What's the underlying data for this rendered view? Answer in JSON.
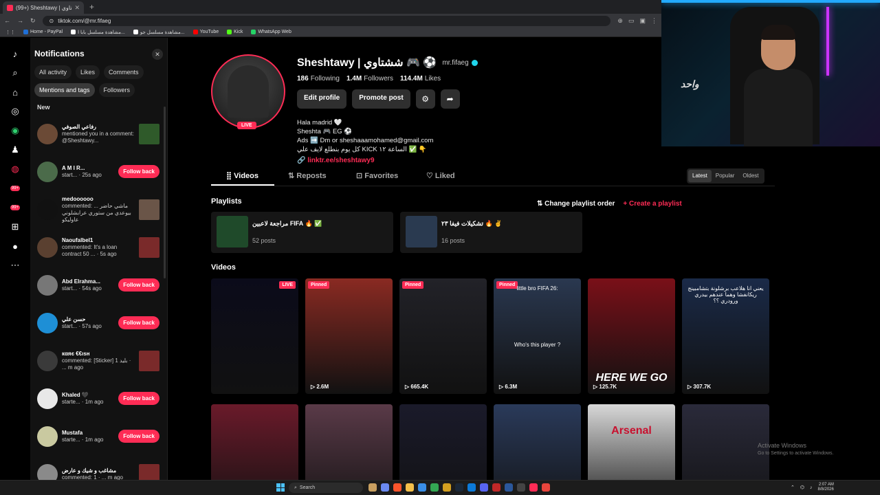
{
  "browser": {
    "tab_title": "(99+) Sheshtawy | شتاوي",
    "url": "tiktok.com/@mr.fifaeg",
    "bookmarks": [
      {
        "label": "Home - PayPal",
        "color": "#1f6fd6"
      },
      {
        "label": "مشاهدة مسلسل بابا ا...",
        "color": "#ffffff"
      },
      {
        "label": "مشاهدة مسلسل جو...",
        "color": "#ffffff"
      },
      {
        "label": "YouTube",
        "color": "#ff0000"
      },
      {
        "label": "Kick",
        "color": "#53fc18"
      },
      {
        "label": "WhatsApp Web",
        "color": "#25d366"
      }
    ]
  },
  "sidebar_badges": [
    "99+",
    "99+"
  ],
  "notifications": {
    "title": "Notifications",
    "filters": [
      "All activity",
      "Likes",
      "Comments",
      "Mentions and tags",
      "Followers"
    ],
    "active_filter": "Mentions and tags",
    "section": "New",
    "items": [
      {
        "name": "رفاعي الصوفي",
        "text": "mentioned you in a comment: @Sheshtawy...",
        "action": "",
        "avatar": "#6b4a36",
        "thumb": "#2f5a2a"
      },
      {
        "name": "A M I R...",
        "text": "start... · 25s ago",
        "action": "Follow back",
        "avatar": "#4b6b4a",
        "thumb": ""
      },
      {
        "name": "medoooooo",
        "text": "commented: ماشي حاضر ... بيوعدي من ستوري عرابشلوني عاوليكو",
        "action": "",
        "avatar": "#111111",
        "thumb": "#6a5548"
      },
      {
        "name": "Naoufalbel1",
        "text": "commented: It's a loan contract 50 ... · 5s ago",
        "action": "",
        "avatar": "#5a4030",
        "thumb": "#7a2a2a"
      },
      {
        "name": "Abd Elrahma...",
        "text": "start... · 54s ago",
        "action": "Follow back",
        "avatar": "#777777",
        "thumb": ""
      },
      {
        "name": "حسن علي",
        "text": "start... · 57s ago",
        "action": "Follow back",
        "avatar": "#1e8fd6",
        "thumb": ""
      },
      {
        "name": "кαяє €€ısн",
        "text": "commented: [Sticker] بليد 1 · ... m ago",
        "action": "",
        "avatar": "#3a3a3a",
        "thumb": "#7a2a2a"
      },
      {
        "name": "Khaled 🖤",
        "text": "starte... · 1m ago",
        "action": "Follow back",
        "avatar": "#e8e8e8",
        "thumb": ""
      },
      {
        "name": "Mustafa",
        "text": "starte... · 1m ago",
        "action": "Follow back",
        "avatar": "#c9c9a0",
        "thumb": ""
      },
      {
        "name": "مشاغب و شيك و عارض",
        "text": "commented: 1 · ... m ago",
        "action": "",
        "avatar": "#8a8a8a",
        "thumb": "#7a2a2a"
      }
    ]
  },
  "profile": {
    "name": "Sheshtawy | ششتاوي 🎮 ⚽",
    "handle": "mr.fifaeg",
    "following": "186",
    "following_label": "Following",
    "followers": "1.4M",
    "followers_label": "Followers",
    "likes": "114.4M",
    "likes_label": "Likes",
    "live": "LIVE",
    "edit_btn": "Edit profile",
    "promote_btn": "Promote post",
    "bio": [
      "Hala madrid 🤍",
      "Sheshta 🎮 EG ⚽",
      "Ads ➡️ Dm or sheshaaamohamed@gmail.com",
      "كل يوم بنطلع لايف علي KICK الساعة ١٢ ✅ 👇"
    ],
    "link": "linktr.ee/sheshtawy9"
  },
  "tabs": [
    "Videos",
    "Reposts",
    "Favorites",
    "Liked"
  ],
  "sort": [
    "Latest",
    "Popular",
    "Oldest"
  ],
  "playlists": {
    "title": "Playlists",
    "change_order": "Change playlist order",
    "create": "+ Create a playlist",
    "items": [
      {
        "title": "مراجعة لاعبين FIFA 🔥 ✅",
        "count": "52 posts",
        "color": "#1f4a2a"
      },
      {
        "title": "تشكيلات فيفا ٢٣ 🔥 ✌️",
        "count": "16 posts",
        "color": "#2a3a50"
      }
    ]
  },
  "videos": {
    "title": "Videos",
    "items": [
      {
        "tag": "LIVE",
        "views": "",
        "caption": "",
        "big": "",
        "bg": "#0b0b1a"
      },
      {
        "tag": "Pinned",
        "views": "▷ 2.6M",
        "caption": "",
        "big": "",
        "bg": "#8a2a22"
      },
      {
        "tag": "Pinned",
        "views": "▷ 665.4K",
        "caption": "",
        "big": "",
        "bg": "#222228"
      },
      {
        "tag": "Pinned",
        "views": "▷ 6.3M",
        "caption": "Who's this player ?",
        "big": "",
        "top": "little bro FIFA 26:",
        "bg": "#2a3850"
      },
      {
        "tag": "",
        "views": "▷ 125.7K",
        "caption": "",
        "big": "HERE WE GO",
        "bg": "#7a1018"
      },
      {
        "tag": "",
        "views": "▷ 307.7K",
        "caption": "",
        "big": "",
        "top": "يعني انا هلاعب برشلونة بتشامبينج ريكانفشا وهما عندهم بيدري ورودري ؟؟",
        "bg": "#1a2a48"
      },
      {
        "tag": "",
        "views": "",
        "caption": "",
        "big": "",
        "bg": "#6a1a2a"
      },
      {
        "tag": "",
        "views": "",
        "caption": "",
        "big": "",
        "bg": "#5a3a48"
      },
      {
        "tag": "",
        "views": "",
        "caption": "",
        "big": "",
        "bg": "#1a1a2a"
      },
      {
        "tag": "",
        "views": "",
        "caption": "",
        "big": "",
        "bg": "#2a3a5a"
      },
      {
        "tag": "",
        "views": "",
        "caption": "Arsenal",
        "big": "",
        "bg": "#d8d8d8"
      },
      {
        "tag": "",
        "views": "",
        "caption": "",
        "big": "",
        "bg": "#2a2a3a"
      }
    ]
  },
  "windows_watermark": {
    "title": "Activate Windows",
    "sub": "Go to Settings to activate Windows."
  },
  "webcam": {
    "shirt_text": "واحد"
  },
  "taskbar": {
    "search_placeholder": "Search",
    "time": "2:07 AM",
    "date": "8/8/2026"
  }
}
